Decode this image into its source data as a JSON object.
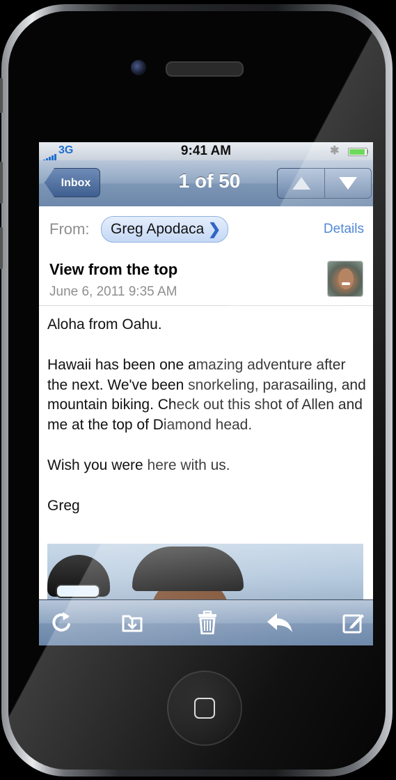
{
  "status_bar": {
    "network": "3G",
    "time": "9:41 AM",
    "bluetooth_icon": "bluetooth-icon",
    "battery_level": 1.0
  },
  "nav": {
    "back_label": "Inbox",
    "counter": "1 of 50",
    "prev_icon": "up-arrow-icon",
    "next_icon": "down-arrow-icon"
  },
  "message": {
    "from_label": "From:",
    "sender": "Greg Apodaca",
    "details_label": "Details",
    "subject": "View from the top",
    "date": "June 6, 2011 9:35 AM",
    "body": [
      "Aloha from Oahu.",
      "Hawaii has been one amazing adventure after the next. We've been snorkeling, parasailing, and mountain biking. Check out this shot of Allen and me at the top of Diamond head.",
      "Wish you were here with us.",
      "Greg"
    ]
  },
  "toolbar": {
    "icons": [
      "refresh-icon",
      "move-to-folder-icon",
      "trash-icon",
      "reply-icon",
      "compose-icon"
    ]
  },
  "colors": {
    "nav_blue": "#7d96b6",
    "link_blue": "#2c6fcf",
    "chip_bg": "#c5d8f5"
  }
}
